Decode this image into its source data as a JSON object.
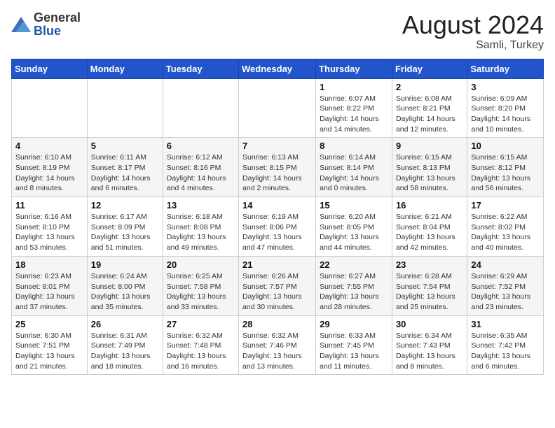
{
  "logo": {
    "general": "General",
    "blue": "Blue"
  },
  "title": {
    "month_year": "August 2024",
    "location": "Samli, Turkey"
  },
  "calendar": {
    "headers": [
      "Sunday",
      "Monday",
      "Tuesday",
      "Wednesday",
      "Thursday",
      "Friday",
      "Saturday"
    ],
    "weeks": [
      [
        {
          "day": "",
          "info": ""
        },
        {
          "day": "",
          "info": ""
        },
        {
          "day": "",
          "info": ""
        },
        {
          "day": "",
          "info": ""
        },
        {
          "day": "1",
          "info": "Sunrise: 6:07 AM\nSunset: 8:22 PM\nDaylight: 14 hours\nand 14 minutes."
        },
        {
          "day": "2",
          "info": "Sunrise: 6:08 AM\nSunset: 8:21 PM\nDaylight: 14 hours\nand 12 minutes."
        },
        {
          "day": "3",
          "info": "Sunrise: 6:09 AM\nSunset: 8:20 PM\nDaylight: 14 hours\nand 10 minutes."
        }
      ],
      [
        {
          "day": "4",
          "info": "Sunrise: 6:10 AM\nSunset: 8:19 PM\nDaylight: 14 hours\nand 8 minutes."
        },
        {
          "day": "5",
          "info": "Sunrise: 6:11 AM\nSunset: 8:17 PM\nDaylight: 14 hours\nand 6 minutes."
        },
        {
          "day": "6",
          "info": "Sunrise: 6:12 AM\nSunset: 8:16 PM\nDaylight: 14 hours\nand 4 minutes."
        },
        {
          "day": "7",
          "info": "Sunrise: 6:13 AM\nSunset: 8:15 PM\nDaylight: 14 hours\nand 2 minutes."
        },
        {
          "day": "8",
          "info": "Sunrise: 6:14 AM\nSunset: 8:14 PM\nDaylight: 14 hours\nand 0 minutes."
        },
        {
          "day": "9",
          "info": "Sunrise: 6:15 AM\nSunset: 8:13 PM\nDaylight: 13 hours\nand 58 minutes."
        },
        {
          "day": "10",
          "info": "Sunrise: 6:15 AM\nSunset: 8:12 PM\nDaylight: 13 hours\nand 56 minutes."
        }
      ],
      [
        {
          "day": "11",
          "info": "Sunrise: 6:16 AM\nSunset: 8:10 PM\nDaylight: 13 hours\nand 53 minutes."
        },
        {
          "day": "12",
          "info": "Sunrise: 6:17 AM\nSunset: 8:09 PM\nDaylight: 13 hours\nand 51 minutes."
        },
        {
          "day": "13",
          "info": "Sunrise: 6:18 AM\nSunset: 8:08 PM\nDaylight: 13 hours\nand 49 minutes."
        },
        {
          "day": "14",
          "info": "Sunrise: 6:19 AM\nSunset: 8:06 PM\nDaylight: 13 hours\nand 47 minutes."
        },
        {
          "day": "15",
          "info": "Sunrise: 6:20 AM\nSunset: 8:05 PM\nDaylight: 13 hours\nand 44 minutes."
        },
        {
          "day": "16",
          "info": "Sunrise: 6:21 AM\nSunset: 8:04 PM\nDaylight: 13 hours\nand 42 minutes."
        },
        {
          "day": "17",
          "info": "Sunrise: 6:22 AM\nSunset: 8:02 PM\nDaylight: 13 hours\nand 40 minutes."
        }
      ],
      [
        {
          "day": "18",
          "info": "Sunrise: 6:23 AM\nSunset: 8:01 PM\nDaylight: 13 hours\nand 37 minutes."
        },
        {
          "day": "19",
          "info": "Sunrise: 6:24 AM\nSunset: 8:00 PM\nDaylight: 13 hours\nand 35 minutes."
        },
        {
          "day": "20",
          "info": "Sunrise: 6:25 AM\nSunset: 7:58 PM\nDaylight: 13 hours\nand 33 minutes."
        },
        {
          "day": "21",
          "info": "Sunrise: 6:26 AM\nSunset: 7:57 PM\nDaylight: 13 hours\nand 30 minutes."
        },
        {
          "day": "22",
          "info": "Sunrise: 6:27 AM\nSunset: 7:55 PM\nDaylight: 13 hours\nand 28 minutes."
        },
        {
          "day": "23",
          "info": "Sunrise: 6:28 AM\nSunset: 7:54 PM\nDaylight: 13 hours\nand 25 minutes."
        },
        {
          "day": "24",
          "info": "Sunrise: 6:29 AM\nSunset: 7:52 PM\nDaylight: 13 hours\nand 23 minutes."
        }
      ],
      [
        {
          "day": "25",
          "info": "Sunrise: 6:30 AM\nSunset: 7:51 PM\nDaylight: 13 hours\nand 21 minutes."
        },
        {
          "day": "26",
          "info": "Sunrise: 6:31 AM\nSunset: 7:49 PM\nDaylight: 13 hours\nand 18 minutes."
        },
        {
          "day": "27",
          "info": "Sunrise: 6:32 AM\nSunset: 7:48 PM\nDaylight: 13 hours\nand 16 minutes."
        },
        {
          "day": "28",
          "info": "Sunrise: 6:32 AM\nSunset: 7:46 PM\nDaylight: 13 hours\nand 13 minutes."
        },
        {
          "day": "29",
          "info": "Sunrise: 6:33 AM\nSunset: 7:45 PM\nDaylight: 13 hours\nand 11 minutes."
        },
        {
          "day": "30",
          "info": "Sunrise: 6:34 AM\nSunset: 7:43 PM\nDaylight: 13 hours\nand 8 minutes."
        },
        {
          "day": "31",
          "info": "Sunrise: 6:35 AM\nSunset: 7:42 PM\nDaylight: 13 hours\nand 6 minutes."
        }
      ]
    ]
  }
}
